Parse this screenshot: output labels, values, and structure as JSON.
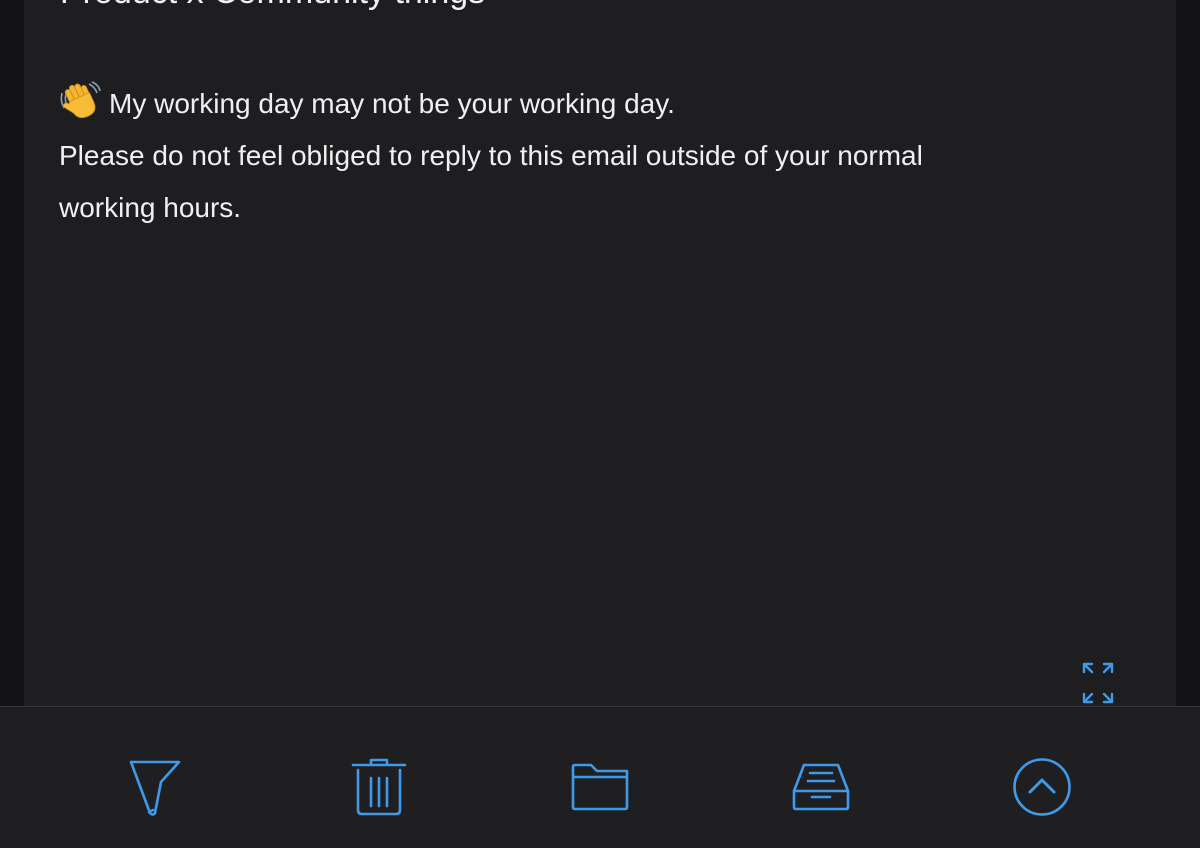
{
  "message": {
    "signature_title": "Product x Community things",
    "body_lines": [
      "My working day may not be your working day.",
      "Please do not feel obliged to reply to this email outside of your normal",
      "working hours."
    ],
    "leading_emoji": "waving-hand-icon"
  },
  "expand": {
    "icon": "expand-arrows-icon"
  },
  "toolbar": {
    "items": [
      {
        "name": "flag",
        "icon": "flag-icon"
      },
      {
        "name": "trash",
        "icon": "trash-icon"
      },
      {
        "name": "move-to-folder",
        "icon": "folder-icon"
      },
      {
        "name": "archive",
        "icon": "archive-tray-icon"
      },
      {
        "name": "scroll-up",
        "icon": "chevron-up-circle-icon"
      }
    ]
  },
  "colors": {
    "background": "#131315",
    "card": "#1e1e20",
    "toolbar": "#1f1f22",
    "text": "#f0f0f2",
    "accent": "#3f9bea"
  }
}
